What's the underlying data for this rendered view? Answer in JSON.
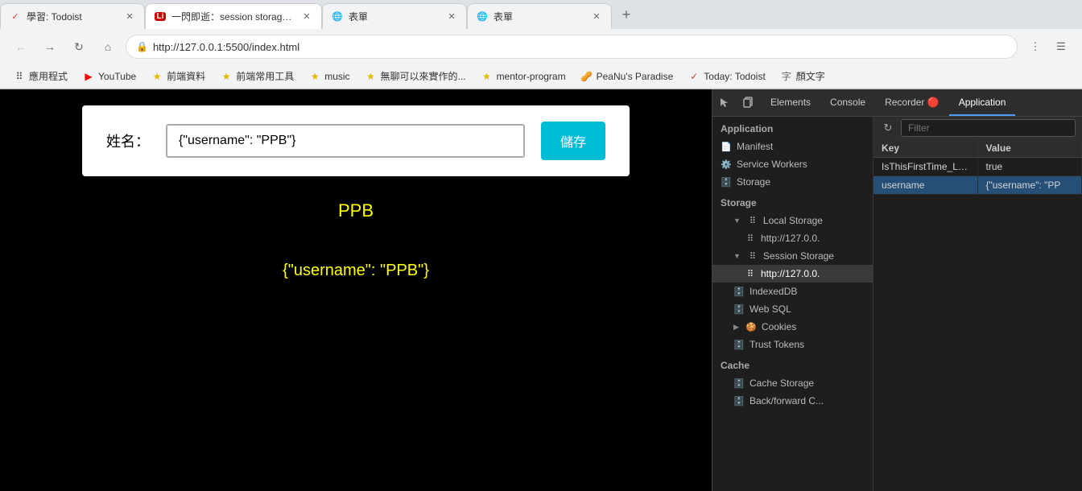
{
  "tabs": [
    {
      "id": "tab1",
      "icon": "todoist",
      "title": "學習: Todoist",
      "active": false
    },
    {
      "id": "tab2",
      "icon": "li",
      "title": "一閃即逝：session storage | Lid...",
      "active": true
    },
    {
      "id": "tab3",
      "icon": "globe",
      "title": "表單",
      "active": false
    },
    {
      "id": "tab4",
      "icon": "globe",
      "title": "表單",
      "active": false
    }
  ],
  "addressBar": {
    "url": "http://127.0.0.1:5500/index.html",
    "lockIcon": "🔒"
  },
  "bookmarks": [
    {
      "id": "apps",
      "icon": "⠿",
      "label": "應用程式"
    },
    {
      "id": "youtube",
      "icon": "▶",
      "label": "YouTube"
    },
    {
      "id": "frontend",
      "icon": "★",
      "label": "前端資料"
    },
    {
      "id": "tools",
      "icon": "★",
      "label": "前端常用工具"
    },
    {
      "id": "music",
      "icon": "★",
      "label": "music"
    },
    {
      "id": "boring",
      "icon": "★",
      "label": "無聊可以來實作的..."
    },
    {
      "id": "mentor",
      "icon": "★",
      "label": "mentor-program"
    },
    {
      "id": "peanu",
      "icon": "🥜",
      "label": "PeaNu's Paradise"
    },
    {
      "id": "todoist",
      "icon": "✓",
      "label": "Today: Todoist"
    },
    {
      "id": "font",
      "icon": "字",
      "label": "顏文字"
    }
  ],
  "pageContent": {
    "formLabel": "姓名：",
    "inputValue": "{\"username\": \"PPB\"}",
    "buttonLabel": "儲存",
    "displayText": "PPB",
    "displayJson": "{\"username\": \"PPB\"}"
  },
  "devtools": {
    "tabs": [
      {
        "id": "elements",
        "label": "Elements"
      },
      {
        "id": "console",
        "label": "Console"
      },
      {
        "id": "recorder",
        "label": "Recorder 🔴"
      },
      {
        "id": "application",
        "label": "Application",
        "active": true
      }
    ],
    "filterPlaceholder": "Filter",
    "sidebar": {
      "applicationLabel": "Application",
      "items": [
        {
          "id": "manifest",
          "label": "Manifest",
          "icon": "📄",
          "indent": 0
        },
        {
          "id": "service-workers",
          "label": "Service Workers",
          "icon": "⚙️",
          "indent": 0
        },
        {
          "id": "storage",
          "label": "Storage",
          "icon": "🗄️",
          "indent": 0
        }
      ],
      "storageLabel": "Storage",
      "storageItems": [
        {
          "id": "local-storage",
          "label": "Local Storage",
          "icon": "⠿",
          "indent": 1,
          "arrow": "▼",
          "expandable": true
        },
        {
          "id": "local-storage-url",
          "label": "http://127.0.0.",
          "icon": "⠿",
          "indent": 2
        },
        {
          "id": "session-storage",
          "label": "Session Storage",
          "icon": "⠿",
          "indent": 1,
          "arrow": "▼",
          "expandable": true,
          "active": true
        },
        {
          "id": "session-storage-url",
          "label": "http://127.0.0.",
          "icon": "⠿",
          "indent": 2,
          "active": true
        },
        {
          "id": "indexeddb",
          "label": "IndexedDB",
          "icon": "🗄️",
          "indent": 1
        },
        {
          "id": "web-sql",
          "label": "Web SQL",
          "icon": "🗄️",
          "indent": 1
        },
        {
          "id": "cookies",
          "label": "Cookies",
          "icon": "🍪",
          "indent": 1,
          "arrow": "▶",
          "expandable": true
        },
        {
          "id": "trust-tokens",
          "label": "Trust Tokens",
          "icon": "🗄️",
          "indent": 1
        }
      ],
      "cacheLabel": "Cache",
      "cacheItems": [
        {
          "id": "cache-storage",
          "label": "Cache Storage",
          "icon": "🗄️",
          "indent": 1
        },
        {
          "id": "back-forward",
          "label": "Back/forward C...",
          "icon": "🗄️",
          "indent": 1
        }
      ]
    },
    "table": {
      "columns": [
        "Key",
        "Value"
      ],
      "rows": [
        {
          "key": "IsThisFirstTime_Log_...",
          "value": "true",
          "selected": false
        },
        {
          "key": "username",
          "value": "{\"username\": \"PP",
          "selected": true
        }
      ]
    }
  }
}
